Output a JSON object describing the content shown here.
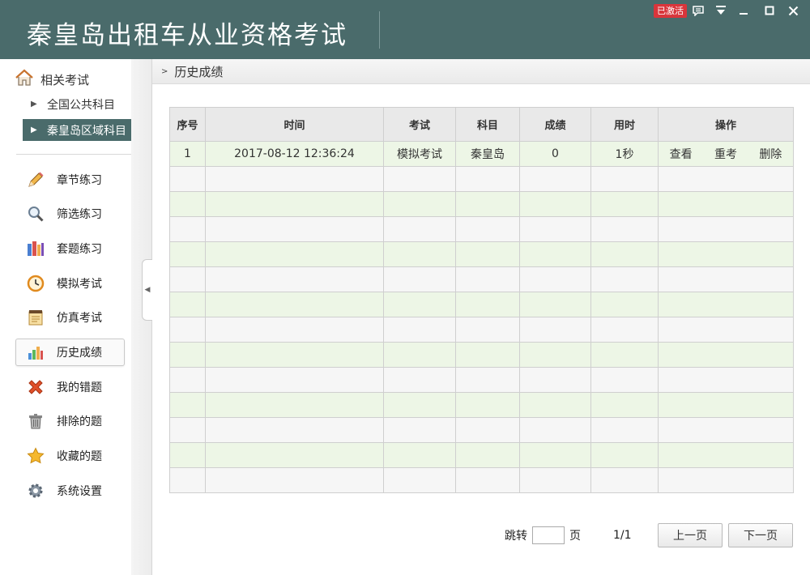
{
  "app": {
    "title": "秦皇岛出租车从业资格考试",
    "badge": "已激活"
  },
  "sidebar": {
    "related_label": "相关考试",
    "sub_items": [
      {
        "label": "全国公共科目"
      },
      {
        "label": "秦皇岛区域科目"
      }
    ],
    "nav": [
      {
        "label": "章节练习",
        "icon": "pencil-icon"
      },
      {
        "label": "筛选练习",
        "icon": "magnifier-icon"
      },
      {
        "label": "套题练习",
        "icon": "books-icon"
      },
      {
        "label": "模拟考试",
        "icon": "clock-icon"
      },
      {
        "label": "仿真考试",
        "icon": "notepad-icon"
      },
      {
        "label": "历史成绩",
        "icon": "bar-chart-icon"
      },
      {
        "label": "我的错题",
        "icon": "red-x-icon"
      },
      {
        "label": "排除的题",
        "icon": "trash-icon"
      },
      {
        "label": "收藏的题",
        "icon": "star-icon"
      },
      {
        "label": "系统设置",
        "icon": "gear-icon"
      }
    ]
  },
  "breadcrumb": {
    "label": "历史成绩"
  },
  "table": {
    "headers": [
      "序号",
      "时间",
      "考试",
      "科目",
      "成绩",
      "用时",
      "操作"
    ],
    "rows": [
      {
        "no": "1",
        "time": "2017-08-12 12:36:24",
        "exam": "模拟考试",
        "subject": "秦皇岛",
        "score": "0",
        "duration": "1秒",
        "actions": [
          "查看",
          "重考",
          "删除"
        ]
      }
    ]
  },
  "pager": {
    "jump_label": "跳转",
    "page_unit": "页",
    "jump_value": "",
    "page_info": "1/1",
    "prev": "上一页",
    "next": "下一页"
  }
}
